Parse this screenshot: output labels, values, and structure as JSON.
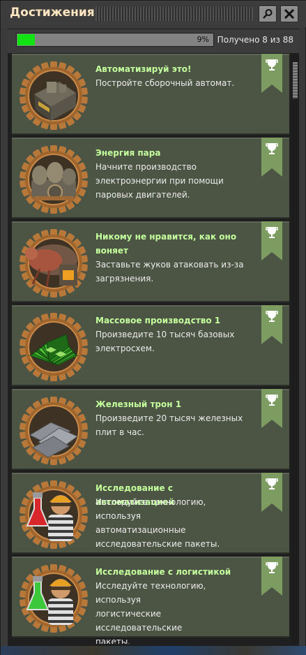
{
  "window": {
    "title": "Достижения",
    "search_icon": "search-icon",
    "close_icon": "close-icon"
  },
  "progress": {
    "percent_label": "9%",
    "fraction": 0.09,
    "summary": "Получено 8 из 88"
  },
  "colors": {
    "accent_green": "#12e312",
    "card_bg": "#4c5444",
    "title_green": "#c4ff9d",
    "ribbon_green": "#7d9c62",
    "gear_bronze": "#b8783a"
  },
  "achievements": [
    {
      "icon": "assembling-machine-icon",
      "title": "Автоматизируй это!",
      "desc": [
        "Постройте сборочный автомат."
      ]
    },
    {
      "icon": "steam-engine-icon",
      "title": "Энергия пара",
      "desc": [
        "Начните производство",
        "электроэнергии при помощи",
        "паровых двигателей."
      ]
    },
    {
      "icon": "biter-icon",
      "title": [
        "Никому не нравится, как оно",
        "воняет"
      ],
      "desc": [
        "Заставьте жуков атаковать из-за",
        "загрязнения."
      ]
    },
    {
      "icon": "electronic-circuit-icon",
      "title": "Массовое производство 1",
      "desc": [
        "Произведите 10 тысяч базовых",
        "электросхем."
      ]
    },
    {
      "icon": "iron-plate-icon",
      "title": "Железный трон 1",
      "desc": [
        "Произведите 20 тысяч железных",
        "плит в час."
      ]
    },
    {
      "icon": "red-science-engineer-icon",
      "title": "Исследование с автоматизацией",
      "desc": [
        "Исследуйте технологию, используя",
        "автоматизационные",
        "исследовательские пакеты."
      ]
    },
    {
      "icon": "green-science-engineer-icon",
      "title": "Исследование с логистикой",
      "desc": [
        "Исследуйте технологию, используя",
        "логистические исследовательские",
        "пакеты."
      ]
    }
  ],
  "ribbon_icon": "trophy-icon"
}
